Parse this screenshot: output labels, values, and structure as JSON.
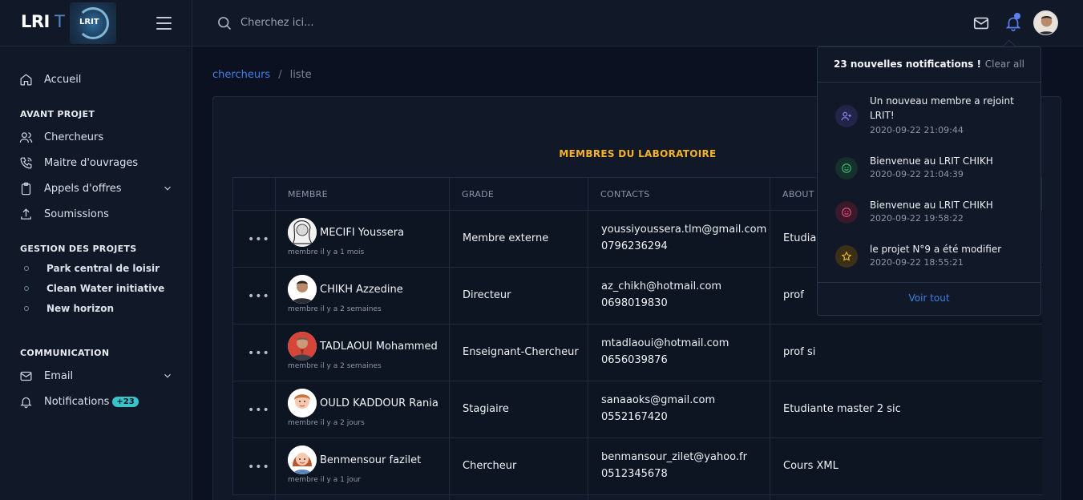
{
  "brand": {
    "name": "LRI",
    "suffix": "T",
    "logo_text": "LRIT"
  },
  "search": {
    "placeholder": "Cherchez ici..."
  },
  "sidebar": {
    "home": "Accueil",
    "section1": "AVANT PROJET",
    "items1": [
      "Chercheurs",
      "Maitre d'ouvrages",
      "Appels d'offres",
      "Soumissions"
    ],
    "section2": "GESTION DES PROJETS",
    "projects": [
      "Park central de loisir",
      "Clean Water initiative",
      "New horizon"
    ],
    "section3": "COMMUNICATION",
    "email": "Email",
    "notifications": "Notifications",
    "notif_badge": "+23"
  },
  "breadcrumb": {
    "link": "chercheurs",
    "separator": "/",
    "current": "liste"
  },
  "card": {
    "title": "MEMBRES DU LABORATOIRE"
  },
  "table": {
    "headers": [
      "MEMBRE",
      "GRADE",
      "CONTACTS",
      "ABOUT"
    ],
    "rows": [
      {
        "name": "MECIFI Youssera",
        "since": "membre il y a 1 mois",
        "grade": "Membre externe",
        "email": "youssiyoussera.tlm@gmail.com",
        "phone": "0796236294",
        "about": "Etudiante"
      },
      {
        "name": "CHIKH Azzedine",
        "since": "membre il y a 2 semaines",
        "grade": "Directeur",
        "email": "az_chikh@hotmail.com",
        "phone": "0698019830",
        "about": "prof"
      },
      {
        "name": "TADLAOUI Mohammed",
        "since": "membre il y a 2 semaines",
        "grade": "Enseignant-Chercheur",
        "email": "mtadlaoui@hotmail.com",
        "phone": "0656039876",
        "about": "prof si"
      },
      {
        "name": "OULD KADDOUR Rania",
        "since": "membre il y a 2 jours",
        "grade": "Stagiaire",
        "email": "sanaaoks@gmail.com",
        "phone": "0552167420",
        "about": "Etudiante master 2 sic"
      },
      {
        "name": "Benmensour fazilet",
        "since": "membre il y a 1 jour",
        "grade": "Chercheur",
        "email": "benmansour_zilet@yahoo.fr",
        "phone": "0512345678",
        "about": "Cours XML"
      }
    ]
  },
  "notifications": {
    "count_label": "23 nouvelles notifications !",
    "clear_label": "Clear all",
    "footer": "Voir tout",
    "items": [
      {
        "text": "Un nouveau membre a rejoint LRIT!",
        "time": "2020-09-22 21:09:44",
        "icon": "user-plus-icon",
        "color": "#8a8cf0"
      },
      {
        "text": "Bienvenue au LRIT CHIKH",
        "time": "2020-09-22 21:04:39",
        "icon": "smile-icon",
        "color": "#2fbf71"
      },
      {
        "text": "Bienvenue au LRIT CHIKH",
        "time": "2020-09-22 19:58:22",
        "icon": "smile-icon",
        "color": "#e04a7a"
      },
      {
        "text": "le projet N°9 a été modifier",
        "time": "2020-09-22 18:55:21",
        "icon": "star-icon",
        "color": "#f5b427"
      }
    ]
  }
}
